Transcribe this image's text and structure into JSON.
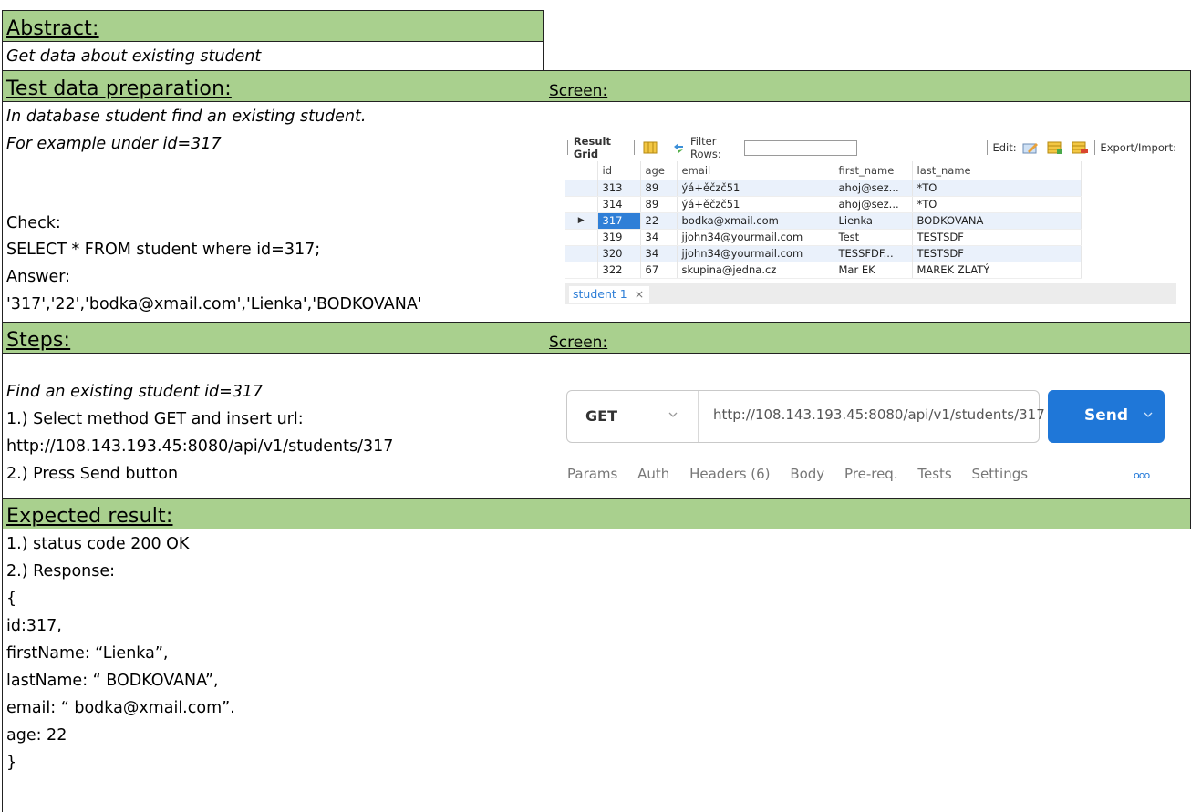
{
  "sections": {
    "abstract_header": "Abstract:",
    "abstract_text": "Get data about existing student",
    "test_data_header": "Test data preparation:",
    "screen_header_1": "Screen:",
    "steps_header": "Steps:",
    "screen_header_2": "Screen:",
    "expected_header": "Expected result:"
  },
  "test_data": {
    "line1": "In database student find an existing student.",
    "line2": "For example under id=317",
    "check_label": "Check:",
    "query": "SELECT * FROM student where id=317;",
    "answer_label": "Answer:",
    "answer": "'317','22','bodka@xmail.com','Lienka','BODKOVANA'"
  },
  "steps": {
    "line1": "Find an existing student id=317",
    "line2": "1.) Select method GET and insert url:",
    "line3": "http://108.143.193.45:8080/api/v1/students/317",
    "line4": "2.) Press Send button"
  },
  "expected": {
    "lines": [
      "1.) status code 200 OK",
      "2.) Response:",
      "{",
      "id:317,",
      "firstName: “Lienka”,",
      "lastName: “ BODKOVANA”,",
      "email: “ bodka@xmail.com”.",
      "age: 22",
      "}"
    ]
  },
  "db_grid": {
    "result_grid_label": "Result Grid",
    "filter_rows_label": "Filter Rows:",
    "edit_label": "Edit:",
    "export_label": "Export/Import:",
    "columns": [
      "id",
      "age",
      "email",
      "first_name",
      "last_name"
    ],
    "rows": [
      [
        "313",
        "89",
        "ýá+ěčzč51",
        "ahoj@sez...",
        "*TO"
      ],
      [
        "314",
        "89",
        "ýá+ěčzč51",
        "ahoj@sez...",
        "*TO"
      ],
      [
        "317",
        "22",
        "bodka@xmail.com",
        "Lienka",
        "BODKOVANA"
      ],
      [
        "319",
        "34",
        "jjohn34@yourmail.com",
        "Test",
        "TESTSDF"
      ],
      [
        "320",
        "34",
        "jjohn34@yourmail.com",
        "TESSFDF...",
        "TESTSDF"
      ],
      [
        "322",
        "67",
        "skupina@jedna.cz",
        "Mar EK",
        "MAREK ZLATÝ"
      ]
    ],
    "selected_row_marker": "▶",
    "tab_label": "student 1",
    "tab_close": "×"
  },
  "postman": {
    "method": "GET",
    "url": "http://108.143.193.45:8080/api/v1/students/317",
    "send_label": "Send",
    "tabs": [
      "Params",
      "Auth",
      "Headers (6)",
      "Body",
      "Pre-req.",
      "Tests",
      "Settings"
    ],
    "more": "ooo"
  },
  "colors": {
    "header_green": "#a9d08e",
    "send_blue": "#1f77d8",
    "grid_selection": "#2f7fd7"
  }
}
